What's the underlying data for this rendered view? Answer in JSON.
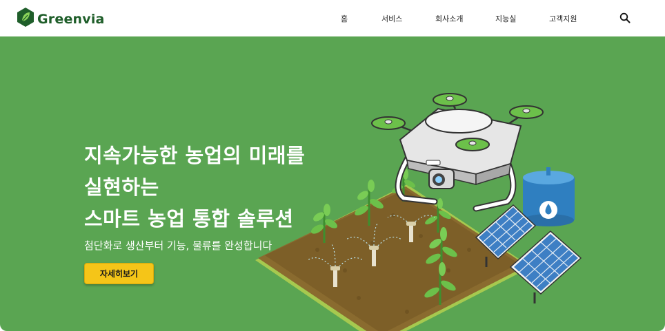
{
  "header": {
    "brand": "Greenvia",
    "nav": [
      {
        "label": "홈"
      },
      {
        "label": "서비스"
      },
      {
        "label": "회사소개"
      },
      {
        "label": "지능실"
      },
      {
        "label": "고객지원"
      }
    ],
    "search_icon": "search-icon"
  },
  "hero": {
    "title_lines": [
      "지속가능한 농업의 미래를",
      "실현하는",
      "스마트 농업 통합 솔루션"
    ],
    "subtitle": "첨단화로 생산부터 기능, 물류를 완성합니다",
    "cta_label": "자세히보기"
  },
  "colors": {
    "brand_green": "#1f5e2a",
    "hero_bg": "#5aa552",
    "cta": "#f5c518"
  }
}
